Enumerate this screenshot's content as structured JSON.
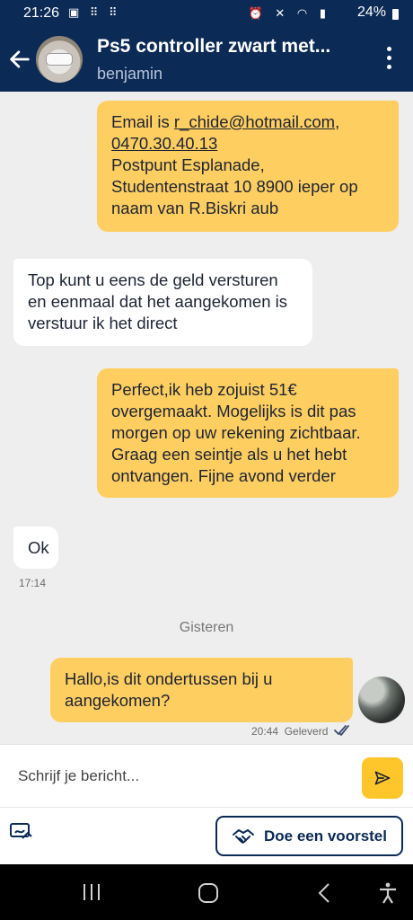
{
  "status_bar": {
    "time": "21:26",
    "battery": "24%"
  },
  "header": {
    "title": "Ps5 controller zwart met...",
    "subtitle": "benjamin"
  },
  "messages": [
    {
      "direction": "outgoing",
      "line1": "Email is ",
      "email": "r_chide@hotmail.com",
      "line1_end": ",",
      "phone": "0470.30.40.13",
      "rest": "Postpunt Esplanade, Studentenstraat 10 8900  ieper op naam van R.Biskri aub"
    },
    {
      "direction": "incoming",
      "text": "Top kunt u eens de geld versturen en eenmaal dat het aangekomen is verstuur ik het direct"
    },
    {
      "direction": "outgoing",
      "text": "Perfect,ik heb zojuist 51€ overgemaakt. Mogelijks is dit pas morgen op uw rekening zichtbaar. Graag een seintje als u het hebt ontvangen. Fijne avond verder"
    },
    {
      "direction": "incoming",
      "text": "Ok",
      "time": "17:14"
    },
    {
      "direction": "outgoing",
      "text": "Hallo,is dit ondertussen bij u aangekomen?",
      "time": "20:44",
      "status": "Geleverd"
    }
  ],
  "day_separator": "Gisteren",
  "composer": {
    "placeholder": "Schrijf je bericht..."
  },
  "actions": {
    "propose_label": "Doe een voorstel"
  },
  "colors": {
    "header_bg": "#0b2a55",
    "outgoing_bubble": "#ffce61",
    "incoming_bubble": "#ffffff",
    "send_button": "#ffc62b"
  }
}
